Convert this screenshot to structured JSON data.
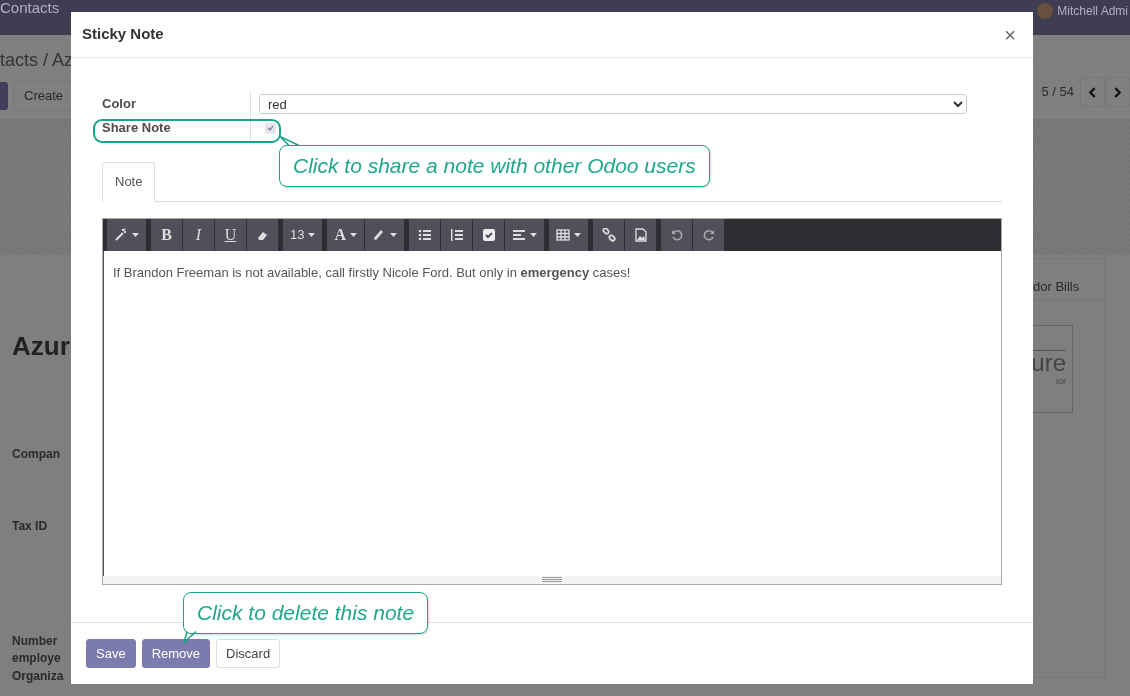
{
  "background": {
    "app_title": "Contacts",
    "user": "Mitchell Admi",
    "breadcrumb": "tacts / Az",
    "create_button": "Create",
    "pager": "5 / 54",
    "tab_label": "dor Bills",
    "record_title": "Azur",
    "logo_text": "ure",
    "logo_subtext": "ior",
    "field_labels": [
      {
        "lines": [
          "Compan"
        ]
      },
      {
        "lines": [
          "Tax ID"
        ]
      },
      {
        "lines": [
          "Number",
          "employe",
          "Organiza"
        ]
      }
    ]
  },
  "dialog": {
    "title": "Sticky Note",
    "close": "×",
    "fields": [
      {
        "label": "Color",
        "kind": "select",
        "value": "red",
        "highlighted": false
      },
      {
        "label": "Share Note",
        "kind": "checkbox",
        "checked": true,
        "highlighted": true
      }
    ],
    "tabs": [
      {
        "label": "Note",
        "selected": true
      }
    ],
    "toolbar": [
      [
        {
          "dropdown": true
        }
      ],
      [
        {
          "text": "B",
          "dropdown": false
        },
        {
          "text": "I",
          "dropdown": false
        },
        {
          "text": "U",
          "dropdown": false
        },
        {
          "dropdown": false
        }
      ],
      [
        {
          "text": "13",
          "dropdown": true
        }
      ],
      [
        {
          "text": "A",
          "dropdown": true
        },
        {
          "dropdown": true
        }
      ],
      [
        {
          "dropdown": false
        },
        {
          "dropdown": false
        },
        {
          "dropdown": false
        },
        {
          "dropdown": true
        }
      ],
      [
        {
          "dropdown": true
        }
      ],
      [
        {
          "dropdown": false
        },
        {
          "dropdown": false
        }
      ],
      [
        {
          "dropdown": false
        },
        {
          "dropdown": false
        }
      ]
    ],
    "content": "If Brandon Freeman is not available, call firstly Nicole Ford. But only in **emergency** cases!",
    "callouts": [
      {
        "text": "Click to share a note with other Odoo users"
      },
      {
        "text": "Click to delete this note"
      }
    ],
    "buttons": [
      {
        "label": "Save",
        "kind": "primary"
      },
      {
        "label": "Remove",
        "kind": "primary"
      },
      {
        "label": "Discard",
        "kind": "secondary"
      }
    ]
  }
}
